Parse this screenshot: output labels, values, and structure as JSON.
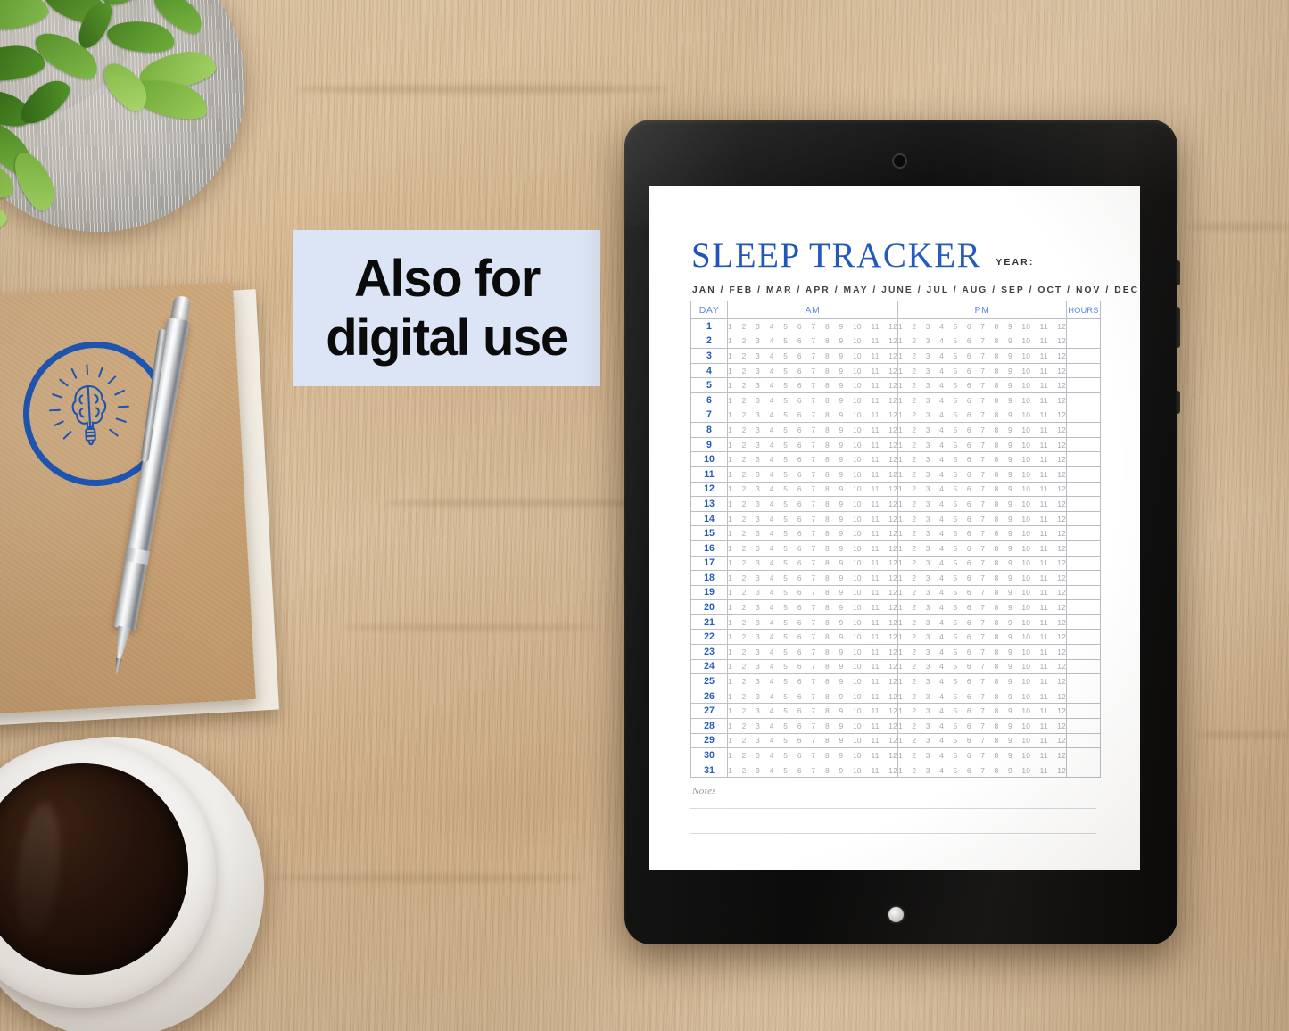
{
  "scene": {
    "background": "wood-desk",
    "wood_color": "#d9bd97"
  },
  "badge": {
    "name": "also-for-digital-use-badge",
    "background": "#dce5f5",
    "line1": "Also for",
    "line2": "digital use"
  },
  "objects": {
    "plant": "potted-succulent-plant",
    "notebook": "kraft-notebook",
    "notebook_logo": "brain-lightbulb-logo",
    "notebook_logo_color": "#1c56b4",
    "pen": "silver-ballpoint-pen",
    "coffee": "cup-of-black-coffee"
  },
  "tablet": {
    "name": "black-tablet",
    "bezel_color": "#101010",
    "camera": "front-camera",
    "home_button": "home-button"
  },
  "document": {
    "title": "SLEEP TRACKER",
    "title_color": "#1a52b8",
    "year_label": "YEAR:",
    "months": "JAN / FEB / MAR / APR / MAY / JUNE / JUL / AUG / SEP / OCT / NOV / DEC",
    "month_list": [
      "JAN",
      "FEB",
      "MAR",
      "APR",
      "MAY",
      "JUNE",
      "JUL",
      "AUG",
      "SEP",
      "OCT",
      "NOV",
      "DEC"
    ],
    "table": {
      "headers": [
        "DAY",
        "AM",
        "PM",
        "HOURS"
      ],
      "header_color": "#5e88d6",
      "day_color": "#1d53bd",
      "hour_marks": [
        "1",
        "2",
        "3",
        "4",
        "5",
        "6",
        "7",
        "8",
        "9",
        "10",
        "11",
        "12"
      ],
      "days": [
        "1",
        "2",
        "3",
        "4",
        "5",
        "6",
        "7",
        "8",
        "9",
        "10",
        "11",
        "12",
        "13",
        "14",
        "15",
        "16",
        "17",
        "18",
        "19",
        "20",
        "21",
        "22",
        "23",
        "24",
        "25",
        "26",
        "27",
        "28",
        "29",
        "30",
        "31"
      ],
      "hours_values": [
        "",
        "",
        "",
        "",
        "",
        "",
        "",
        "",
        "",
        "",
        "",
        "",
        "",
        "",
        "",
        "",
        "",
        "",
        "",
        "",
        "",
        "",
        "",
        "",
        "",
        "",
        "",
        "",
        "",
        "",
        ""
      ]
    },
    "notes": {
      "label": "Notes",
      "line_count": 3
    }
  }
}
